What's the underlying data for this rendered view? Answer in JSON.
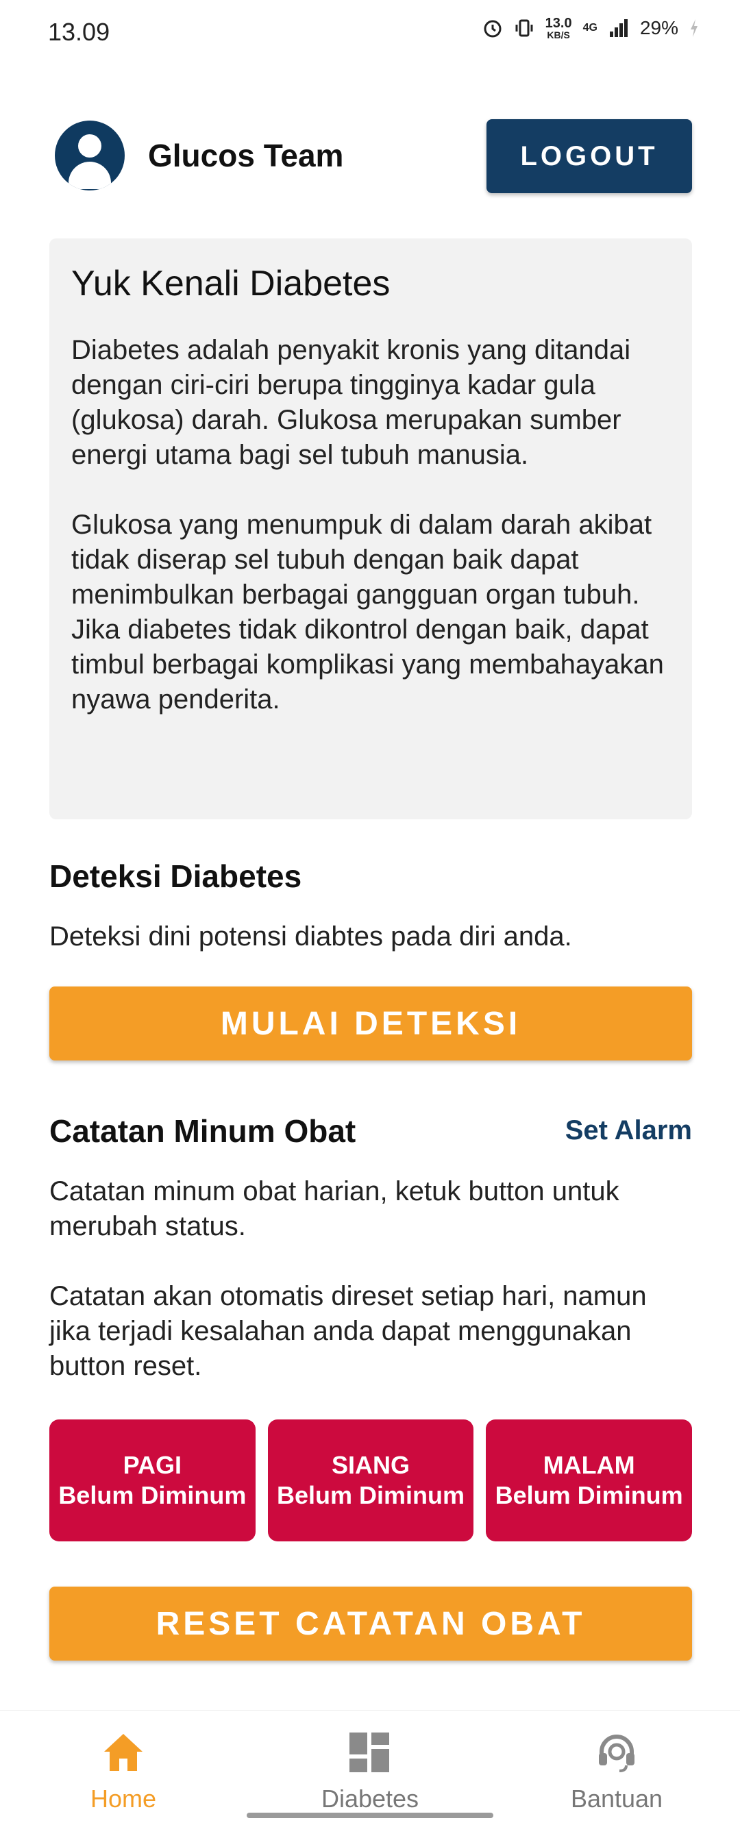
{
  "status_bar": {
    "time": "13.09",
    "speed_value": "13.0",
    "speed_unit": "KB/S",
    "network": "4G",
    "battery": "29%"
  },
  "header": {
    "user_name": "Glucos Team",
    "logout_label": "LOGOUT"
  },
  "info": {
    "title": "Yuk Kenali Diabetes",
    "paragraph1": "Diabetes adalah penyakit kronis yang ditandai dengan ciri-ciri berupa tingginya kadar gula (glukosa) darah. Glukosa merupakan sumber energi utama bagi sel tubuh manusia.",
    "paragraph2": "Glukosa yang menumpuk di dalam darah akibat tidak diserap sel tubuh dengan baik dapat menimbulkan berbagai gangguan organ tubuh. Jika diabetes tidak dikontrol dengan baik, dapat timbul berbagai komplikasi yang membahayakan nyawa penderita."
  },
  "detection": {
    "title": "Deteksi Diabetes",
    "description": "Deteksi dini potensi diabtes pada diri anda.",
    "button_label": "MULAI DETEKSI"
  },
  "medication": {
    "title": "Catatan Minum Obat",
    "set_alarm_label": "Set Alarm",
    "description1": "Catatan minum obat harian, ketuk button untuk merubah status.",
    "description2": "Catatan akan otomatis direset setiap hari, namun jika terjadi kesalahan anda dapat menggunakan button reset.",
    "doses": [
      {
        "time": "PAGI",
        "status": "Belum Diminum"
      },
      {
        "time": "SIANG",
        "status": "Belum Diminum"
      },
      {
        "time": "MALAM",
        "status": "Belum Diminum"
      }
    ],
    "reset_label": "RESET CATATAN OBAT"
  },
  "bottom_nav": {
    "items": [
      {
        "label": "Home",
        "icon": "home-icon",
        "active": true
      },
      {
        "label": "Diabetes",
        "icon": "dashboard-icon",
        "active": false
      },
      {
        "label": "Bantuan",
        "icon": "headset-icon",
        "active": false
      }
    ]
  },
  "colors": {
    "primary": "#143d63",
    "accent": "#f49d26",
    "danger": "#cc0a3e",
    "card_bg": "#f2f2f2"
  }
}
